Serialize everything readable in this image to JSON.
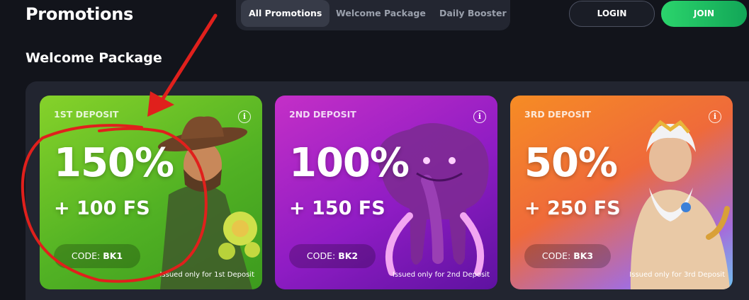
{
  "header": {
    "title": "Promotions",
    "tabs": [
      {
        "label": "All Promotions",
        "active": true
      },
      {
        "label": "Welcome Package",
        "active": false
      },
      {
        "label": "Daily Booster",
        "active": false
      }
    ],
    "login_label": "LOGIN",
    "join_label": "JOIN"
  },
  "section": {
    "title": "Welcome Package"
  },
  "cards": [
    {
      "deposit": "1ST DEPOSIT",
      "percent": "150%",
      "free_spins": "+ 100 FS",
      "code_label": "CODE:",
      "code": "BK1",
      "issued": "Issued only for 1st Deposit",
      "colors": [
        "#86d22a",
        "#3c9a1e"
      ]
    },
    {
      "deposit": "2ND DEPOSIT",
      "percent": "100%",
      "free_spins": "+ 150 FS",
      "code_label": "CODE:",
      "code": "BK2",
      "issued": "Issued only for 2nd Deposit",
      "colors": [
        "#c42fc7",
        "#5e12a0"
      ]
    },
    {
      "deposit": "3RD DEPOSIT",
      "percent": "50%",
      "free_spins": "+ 250 FS",
      "code_label": "CODE:",
      "code": "BK3",
      "issued": "Issued only for 3rd Deposit",
      "colors": [
        "#f68c24",
        "#6ec0f0"
      ]
    }
  ],
  "icons": {
    "info": "info-icon"
  },
  "accent": {
    "join": "#2bd46c",
    "annotation": "#e0201c"
  }
}
